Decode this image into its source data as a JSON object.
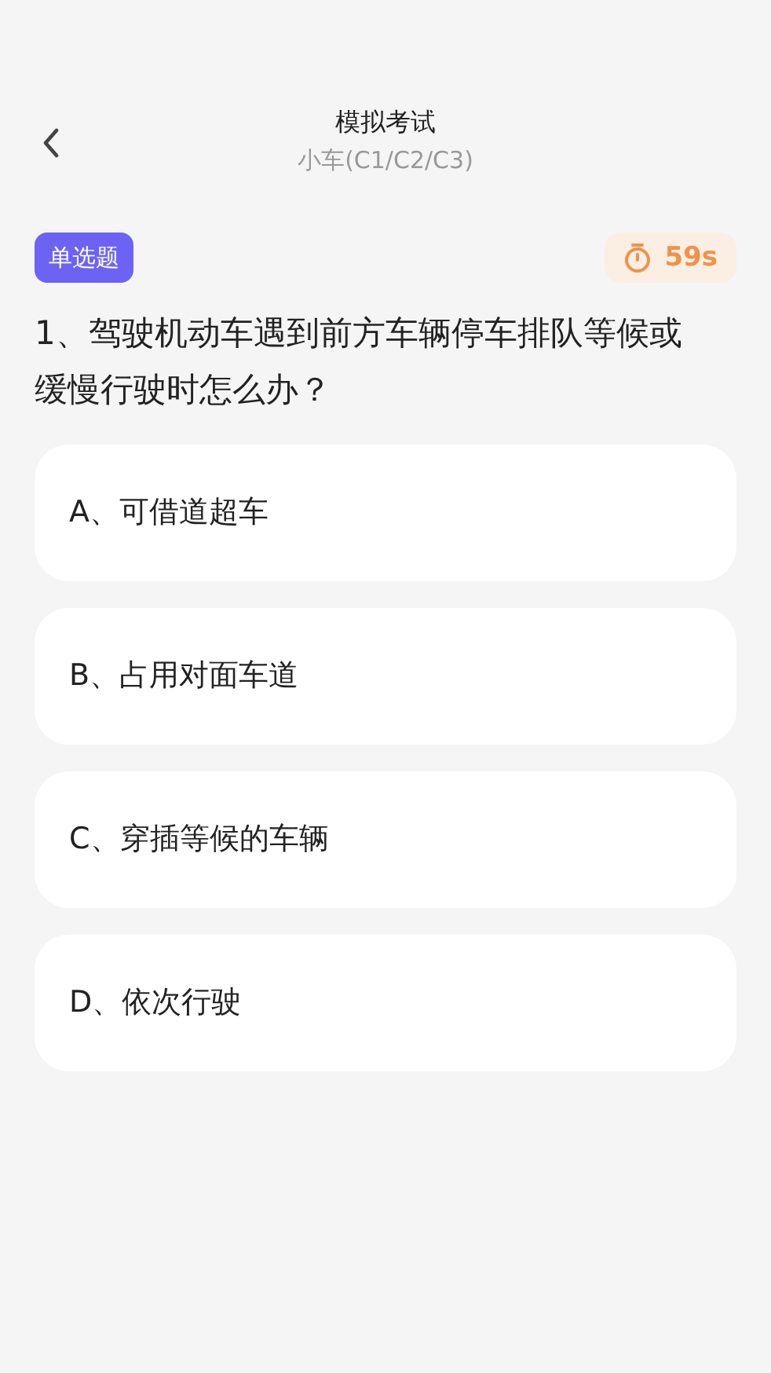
{
  "header": {
    "title": "模拟考试",
    "subtitle": "小车(C1/C2/C3)"
  },
  "question": {
    "type_tag": "单选题",
    "timer": "59s",
    "text": "1、驾驶机动车遇到前方车辆停车排队等候或缓慢行驶时怎么办？"
  },
  "options": [
    {
      "label": "A、可借道超车"
    },
    {
      "label": "B、占用对面车道"
    },
    {
      "label": "C、穿插等候的车辆"
    },
    {
      "label": "D、依次行驶"
    }
  ]
}
